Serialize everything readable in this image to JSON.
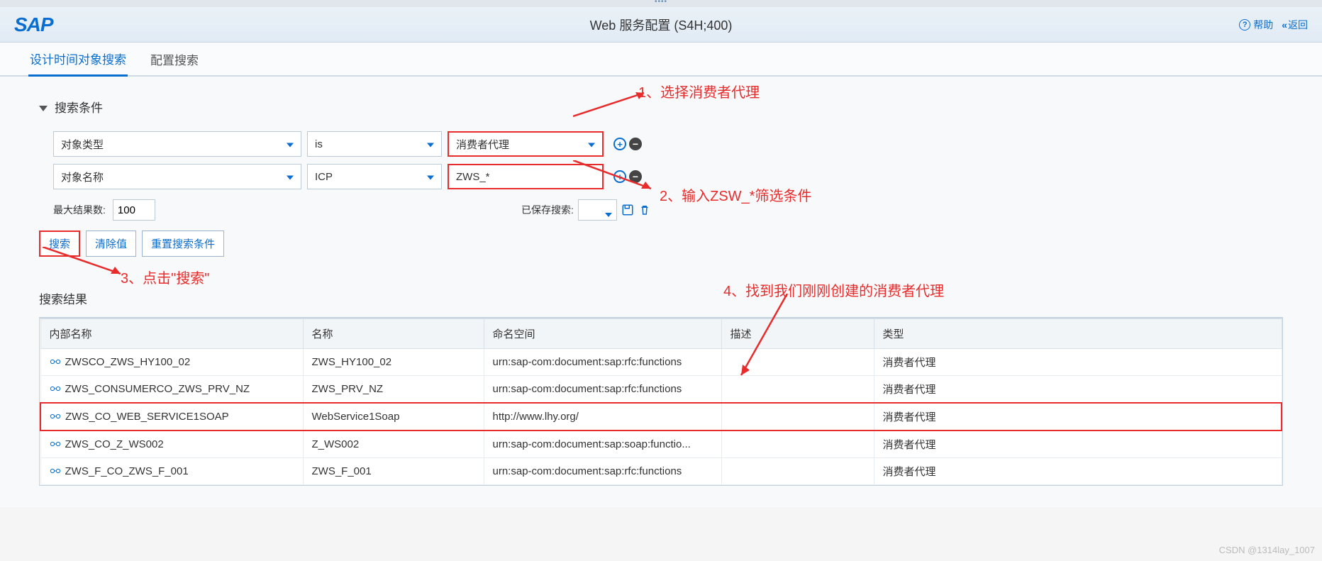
{
  "header": {
    "logo": "SAP",
    "title": "Web 服务配置 (S4H;400)",
    "help": "帮助",
    "back": "返回"
  },
  "tabs": {
    "active": "设计时间对象搜索",
    "other": "配置搜索"
  },
  "criteria": {
    "title": "搜索条件",
    "rows": [
      {
        "field": "对象类型",
        "op": "is",
        "val": "消费者代理"
      },
      {
        "field": "对象名称",
        "op": "ICP",
        "val": "ZWS_*"
      }
    ],
    "max_label": "最大结果数:",
    "max_value": "100",
    "saved_label": "已保存搜索:"
  },
  "buttons": {
    "search": "搜索",
    "clear": "清除值",
    "reset": "重置搜索条件"
  },
  "annotations": {
    "a1": "1、选择消费者代理",
    "a2": "2、输入ZSW_*筛选条件",
    "a3": "3、点击\"搜索\"",
    "a4": "4、找到我们刚刚创建的消费者代理"
  },
  "results": {
    "title": "搜索结果",
    "headers": [
      "内部名称",
      "名称",
      "命名空间",
      "描述",
      "类型"
    ],
    "rows": [
      {
        "internal": "ZWSCO_ZWS_HY100_02",
        "name": "ZWS_HY100_02",
        "ns": "urn:sap-com:document:sap:rfc:functions",
        "desc": "",
        "type": "消费者代理",
        "hl": false
      },
      {
        "internal": "ZWS_CONSUMERCO_ZWS_PRV_NZ",
        "name": "ZWS_PRV_NZ",
        "ns": "urn:sap-com:document:sap:rfc:functions",
        "desc": "",
        "type": "消费者代理",
        "hl": false
      },
      {
        "internal": "ZWS_CO_WEB_SERVICE1SOAP",
        "name": "WebService1Soap",
        "ns": "http://www.lhy.org/",
        "desc": "",
        "type": "消费者代理",
        "hl": true
      },
      {
        "internal": "ZWS_CO_Z_WS002",
        "name": "Z_WS002",
        "ns": "urn:sap-com:document:sap:soap:functio...",
        "desc": "",
        "type": "消费者代理",
        "hl": false
      },
      {
        "internal": "ZWS_F_CO_ZWS_F_001",
        "name": "ZWS_F_001",
        "ns": "urn:sap-com:document:sap:rfc:functions",
        "desc": "",
        "type": "消费者代理",
        "hl": false
      }
    ]
  },
  "watermark": "CSDN @1314lay_1007"
}
